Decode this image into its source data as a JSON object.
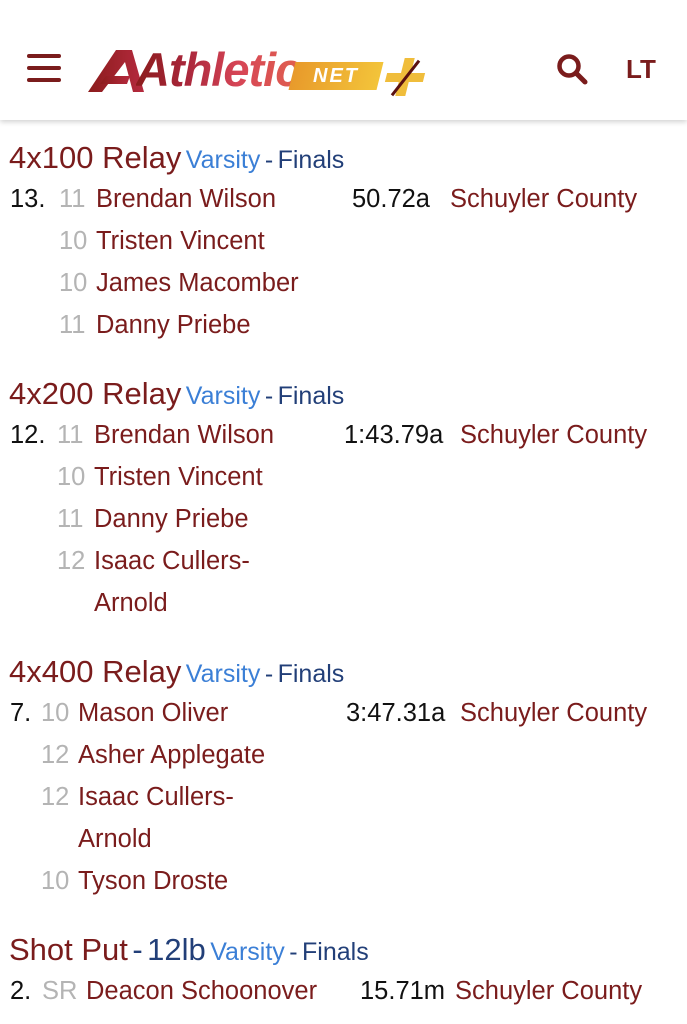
{
  "header": {
    "logo_text": "Athletic",
    "logo_net": "NET",
    "user_initials": "LT",
    "colors": {
      "brand": "#7a1c1c",
      "accent": "#f0bd3b",
      "link": "#3b7fd6",
      "navy": "#223f78"
    },
    "icons": {
      "menu": "hamburger-icon",
      "search": "search-icon",
      "plus": "plus-icon"
    }
  },
  "events": [
    {
      "name": "4x100 Relay",
      "level": "Varsity",
      "separator": "-",
      "round": "Finals",
      "place": "13.",
      "mark": "50.72a",
      "team": "Schuyler County",
      "legs": [
        {
          "grade": "11",
          "name": "Brendan Wilson"
        },
        {
          "grade": "10",
          "name": "Tristen Vincent"
        },
        {
          "grade": "10",
          "name": "James Macomber"
        },
        {
          "grade": "11",
          "name": "Danny Priebe"
        }
      ]
    },
    {
      "name": "4x200 Relay",
      "level": "Varsity",
      "separator": "-",
      "round": "Finals",
      "place": "12.",
      "mark": "1:43.79a",
      "team": "Schuyler County",
      "legs": [
        {
          "grade": "11",
          "name": "Brendan Wilson"
        },
        {
          "grade": "10",
          "name": "Tristen Vincent"
        },
        {
          "grade": "11",
          "name": "Danny Priebe"
        },
        {
          "grade": "12",
          "name": "Isaac Cullers-",
          "name_cont": "Arnold"
        }
      ]
    },
    {
      "name": "4x400 Relay",
      "level": "Varsity",
      "separator": "-",
      "round": "Finals",
      "place": "7.",
      "mark": "3:47.31a",
      "team": "Schuyler County",
      "legs": [
        {
          "grade": "10",
          "name": "Mason Oliver"
        },
        {
          "grade": "12",
          "name": "Asher Applegate"
        },
        {
          "grade": "12",
          "name": "Isaac Cullers-",
          "name_cont": "Arnold"
        },
        {
          "grade": "10",
          "name": "Tyson Droste"
        }
      ]
    },
    {
      "name": "Shot Put",
      "separator_a": "-",
      "weight": "12lb",
      "level": "Varsity",
      "separator": "-",
      "round": "Finals",
      "place": "2.",
      "grade": "SR",
      "athlete": "Deacon Schoonover",
      "mark": "15.71m",
      "team": "Schuyler County"
    }
  ]
}
